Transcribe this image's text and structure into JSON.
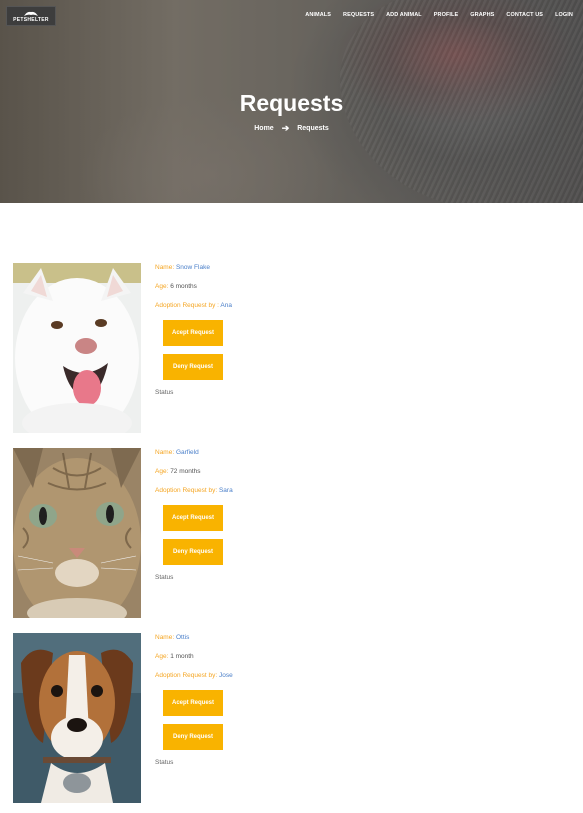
{
  "brand": {
    "logo_text": "PETSHELTER"
  },
  "nav": {
    "items": [
      "ANIMALS",
      "REQUESTS",
      "ADD ANIMAL",
      "PROFILE",
      "GRAPHS",
      "CONTACT US",
      "LOGIN"
    ]
  },
  "hero": {
    "title": "Requests",
    "breadcrumb_home": "Home",
    "breadcrumb_current": "Requests"
  },
  "labels": {
    "name": "Name:",
    "age": "Age:",
    "adoption_by": "Adoption Request by:",
    "accept_button": "Acept Request",
    "deny_button": "Deny Request",
    "status": "Status"
  },
  "requests": [
    {
      "name": "Snow Flake",
      "age": "6 months",
      "requester": "Ana",
      "label_by": "Adoption Request by :"
    },
    {
      "name": "Garfield",
      "age": "72 months",
      "requester": "Sara",
      "label_by": "Adoption Request by:"
    },
    {
      "name": "Ottis",
      "age": "1 month",
      "requester": "Jose",
      "label_by": "Adoption Request by:"
    }
  ],
  "colors": {
    "accent": "#f9b300",
    "label": "#f5a623",
    "link": "#4a7fc9"
  }
}
